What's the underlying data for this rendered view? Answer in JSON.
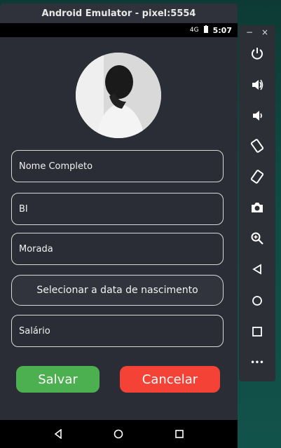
{
  "window": {
    "title": "Android Emulator - pixel:5554"
  },
  "status_bar": {
    "signal": "4G",
    "time": "5:07"
  },
  "form": {
    "full_name_placeholder": "Nome Completo",
    "bi_placeholder": "BI",
    "address_placeholder": "Morada",
    "birthdate_button": "Selecionar a data de nascimento",
    "salary_placeholder": "Salário",
    "save_label": "Salvar",
    "cancel_label": "Cancelar"
  },
  "toolbar": {
    "minimize": "−",
    "close": "×",
    "more": "•••"
  },
  "colors": {
    "save": "#4caf50",
    "cancel": "#f44336",
    "background": "#2a2d35"
  }
}
